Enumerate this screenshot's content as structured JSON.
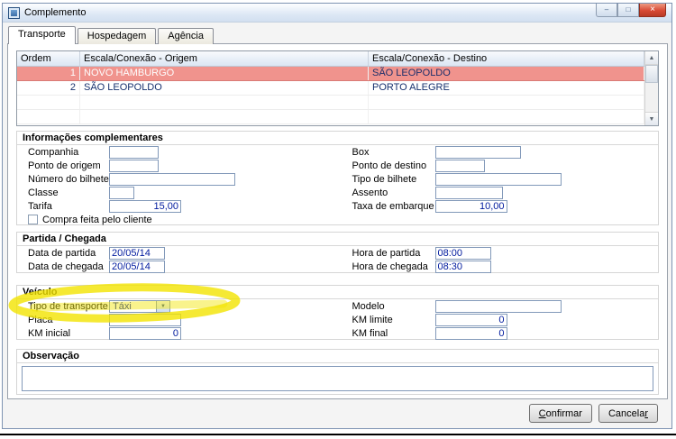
{
  "window": {
    "title": "Complemento",
    "icons": {
      "minimize": "–",
      "maximize": "□",
      "close": "×"
    }
  },
  "tabs": [
    {
      "label": "Transporte"
    },
    {
      "label": "Hospedagem"
    },
    {
      "label": "Agência"
    }
  ],
  "grid": {
    "columns": [
      "Ordem",
      "Escala/Conexão - Origem",
      "Escala/Conexão - Destino"
    ],
    "rows": [
      {
        "ordem": "1",
        "origem": "NOVO HAMBURGO",
        "destino": "SÃO LEOPOLDO"
      },
      {
        "ordem": "2",
        "origem": "SÃO LEOPOLDO",
        "destino": "PORTO ALEGRE"
      }
    ]
  },
  "icons": {
    "dropdown": "▼",
    "scroll_up": "▲",
    "scroll_down": "▼"
  },
  "sections": {
    "info": {
      "title": "Informações complementares",
      "companhia": {
        "label": "Companhia",
        "value": ""
      },
      "box": {
        "label": "Box",
        "value": ""
      },
      "ponto_origem": {
        "label": "Ponto de origem",
        "value": ""
      },
      "ponto_destino": {
        "label": "Ponto de destino",
        "value": ""
      },
      "numero_bilhete": {
        "label": "Número do bilhete",
        "value": ""
      },
      "tipo_bilhete": {
        "label": "Tipo de bilhete",
        "value": ""
      },
      "classe": {
        "label": "Classe",
        "value": ""
      },
      "assento": {
        "label": "Assento",
        "value": ""
      },
      "tarifa": {
        "label": "Tarifa",
        "value": "15,00"
      },
      "taxa_embarque": {
        "label": "Taxa de embarque",
        "value": "10,00"
      },
      "compra_cliente": {
        "label": "Compra feita pelo cliente"
      }
    },
    "partida": {
      "title": "Partida / Chegada",
      "data_partida": {
        "label": "Data de partida",
        "value": "20/05/14"
      },
      "hora_partida": {
        "label": "Hora de partida",
        "value": "08:00"
      },
      "data_chegada": {
        "label": "Data de chegada",
        "value": "20/05/14"
      },
      "hora_chegada": {
        "label": "Hora de chegada",
        "value": "08:30"
      }
    },
    "veiculo": {
      "title": "Veículo",
      "tipo_transporte": {
        "label": "Tipo de transporte",
        "value": "Táxi"
      },
      "modelo": {
        "label": "Modelo",
        "value": ""
      },
      "placa": {
        "label": "Placa",
        "value": ""
      },
      "km_limite": {
        "label": "KM limite",
        "value": "0"
      },
      "km_inicial": {
        "label": "KM inicial",
        "value": "0"
      },
      "km_final": {
        "label": "KM final",
        "value": "0"
      }
    },
    "observacao": {
      "title": "Observação",
      "value": ""
    }
  },
  "buttons": {
    "confirmar": {
      "pre": "",
      "key": "C",
      "post": "onfirmar"
    },
    "cancelar": {
      "pre": "Cancela",
      "key": "r",
      "post": ""
    }
  },
  "colors": {
    "highlight_marker": "#F2E400",
    "selected_row": "#F0938D",
    "value_text": "#001A9E",
    "close_button": "#D84A35"
  }
}
